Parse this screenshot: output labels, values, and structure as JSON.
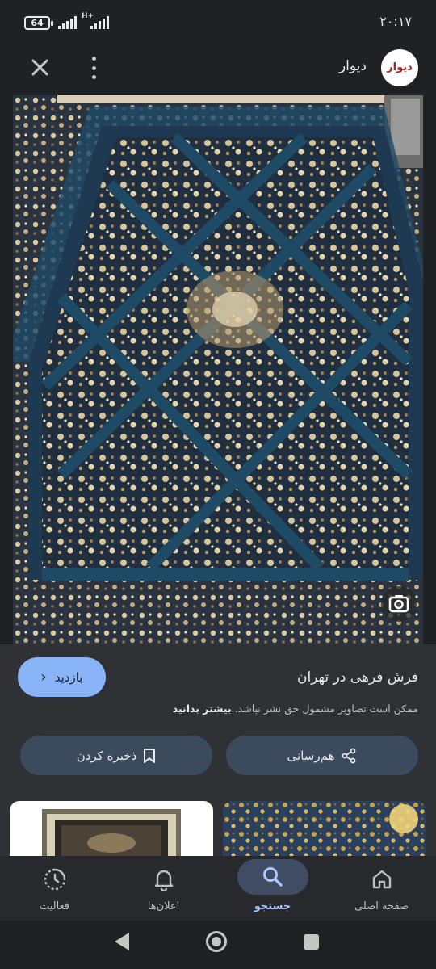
{
  "status_bar": {
    "battery": "64",
    "network": "H+",
    "time": "۲۰:۱۷"
  },
  "header": {
    "site_name": "دیوار",
    "logo_text": "دیوار",
    "close_icon": "close-icon",
    "menu_icon": "more-vert-icon"
  },
  "result": {
    "title": "فرش فرهی در تهران",
    "visit_label": "بازدید",
    "notice": "ممکن است تصاویر مشمول حق نشر نباشد.",
    "learn_more": "بیشتر بدانید",
    "share_label": "هم‌رسانی",
    "save_label": "ذخیره کردن"
  },
  "bottom_nav": {
    "items": [
      {
        "label": "فعالیت",
        "icon": "activity-icon"
      },
      {
        "label": "اعلان‌ها",
        "icon": "bell-icon"
      },
      {
        "label": "جستجو",
        "icon": "search-icon",
        "active": true
      },
      {
        "label": "صفحه اصلی",
        "icon": "home-icon"
      }
    ]
  },
  "colors": {
    "background": "#202124",
    "panel": "#303134",
    "accent": "#8ab4f8",
    "pill": "#3c4a5e",
    "carpet_field": "#1e3548",
    "carpet_motif": "#c8b48c"
  }
}
